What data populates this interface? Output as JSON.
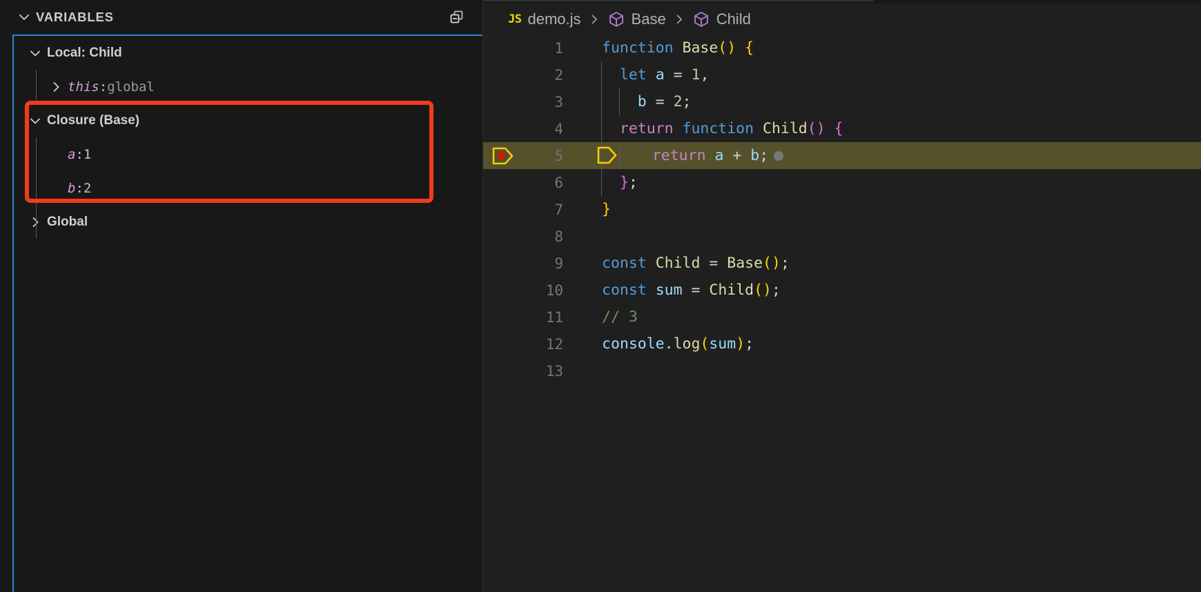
{
  "sidebar": {
    "panel_title": "VARIABLES",
    "twisty_expanded_icon": "chevron-down-icon",
    "collapse_all_icon": "collapse-all-icon",
    "tree": [
      {
        "kind": "scope",
        "label": "Local: Child",
        "expanded": true,
        "icon": "chevron-down-icon",
        "indent": 0
      },
      {
        "kind": "variable",
        "name": "this",
        "separator": ": ",
        "value": "global",
        "value_type": "object",
        "expanded": false,
        "icon": "chevron-right-icon",
        "indent": 1
      },
      {
        "kind": "scope",
        "label": "Closure (Base)",
        "expanded": true,
        "icon": "chevron-down-icon",
        "indent": 0,
        "highlighted": true
      },
      {
        "kind": "variable",
        "name": "a",
        "separator": ": ",
        "value": "1",
        "value_type": "number",
        "indent": 1,
        "highlighted": true
      },
      {
        "kind": "variable",
        "name": "b",
        "separator": ": ",
        "value": "2",
        "value_type": "number",
        "indent": 1,
        "highlighted": true
      },
      {
        "kind": "scope",
        "label": "Global",
        "expanded": false,
        "icon": "chevron-right-icon",
        "indent": 0
      }
    ]
  },
  "annotation": {
    "type": "red-rectangle-highlight",
    "color": "#f03c1e",
    "targets": [
      "Closure (Base)",
      "a: 1",
      "b: 2"
    ]
  },
  "editor": {
    "breadcrumbs": [
      {
        "icon": "js-file-icon",
        "label": "demo.js"
      },
      {
        "icon": "symbol-cube-icon",
        "label": "Base"
      },
      {
        "icon": "symbol-cube-icon",
        "label": "Child"
      }
    ],
    "breadcrumb_separator": "chevron-right-icon",
    "colors": {
      "keyword": "#569cd6",
      "control": "#c586c0",
      "function": "#dcdcaa",
      "variable": "#9cdcfe",
      "number": "#b5cea8",
      "comment": "#6a9955",
      "bracket_level1": "#ffd700",
      "bracket_level2": "#da70d6",
      "current_line_bg": "#55512b",
      "breakpoint": "#e51400",
      "debug_arrow": "#ffcc00"
    },
    "current_line": 5,
    "breakpoint_line": 5,
    "lines": [
      {
        "n": "1",
        "indent_guides": 0,
        "tokens": [
          {
            "t": "function",
            "c": "t-kw"
          },
          {
            "t": " ",
            "c": "t-op"
          },
          {
            "t": "Base",
            "c": "t-fn"
          },
          {
            "t": "()",
            "c": "t-br1"
          },
          {
            "t": " ",
            "c": "t-op"
          },
          {
            "t": "{",
            "c": "t-br1"
          }
        ]
      },
      {
        "n": "2",
        "indent_guides": 1,
        "tokens": [
          {
            "t": "  ",
            "c": "t-op"
          },
          {
            "t": "let",
            "c": "t-kw"
          },
          {
            "t": " ",
            "c": "t-op"
          },
          {
            "t": "a",
            "c": "t-var"
          },
          {
            "t": " = ",
            "c": "t-op"
          },
          {
            "t": "1",
            "c": "t-num"
          },
          {
            "t": ",",
            "c": "t-op"
          }
        ]
      },
      {
        "n": "3",
        "indent_guides": 2,
        "tokens": [
          {
            "t": "    ",
            "c": "t-op"
          },
          {
            "t": "b",
            "c": "t-var"
          },
          {
            "t": " = ",
            "c": "t-op"
          },
          {
            "t": "2",
            "c": "t-num"
          },
          {
            "t": ";",
            "c": "t-op"
          }
        ]
      },
      {
        "n": "4",
        "indent_guides": 1,
        "tokens": [
          {
            "t": "  ",
            "c": "t-op"
          },
          {
            "t": "return",
            "c": "t-ctrl"
          },
          {
            "t": " ",
            "c": "t-op"
          },
          {
            "t": "function",
            "c": "t-kw"
          },
          {
            "t": " ",
            "c": "t-op"
          },
          {
            "t": "Child",
            "c": "t-fn"
          },
          {
            "t": "()",
            "c": "t-br2"
          },
          {
            "t": " ",
            "c": "t-op"
          },
          {
            "t": "{",
            "c": "t-br2"
          }
        ]
      },
      {
        "n": "5",
        "indent_guides": 2,
        "current": true,
        "has_breakpoint": true,
        "has_inline_bp_dot": true,
        "tokens": [
          {
            "t": "   ",
            "c": "t-op"
          },
          {
            "t": "return",
            "c": "t-ctrl"
          },
          {
            "t": " ",
            "c": "t-op"
          },
          {
            "t": "a",
            "c": "t-var"
          },
          {
            "t": " + ",
            "c": "t-op"
          },
          {
            "t": "b",
            "c": "t-var"
          },
          {
            "t": ";",
            "c": "t-op"
          }
        ]
      },
      {
        "n": "6",
        "indent_guides": 1,
        "tokens": [
          {
            "t": "  ",
            "c": "t-op"
          },
          {
            "t": "}",
            "c": "t-br2"
          },
          {
            "t": ";",
            "c": "t-op"
          }
        ]
      },
      {
        "n": "7",
        "indent_guides": 0,
        "tokens": [
          {
            "t": "}",
            "c": "t-br1"
          }
        ]
      },
      {
        "n": "8",
        "indent_guides": 0,
        "tokens": []
      },
      {
        "n": "9",
        "indent_guides": 0,
        "tokens": [
          {
            "t": "const",
            "c": "t-kw"
          },
          {
            "t": " ",
            "c": "t-op"
          },
          {
            "t": "Child",
            "c": "t-fn"
          },
          {
            "t": " = ",
            "c": "t-op"
          },
          {
            "t": "Base",
            "c": "t-fn"
          },
          {
            "t": "()",
            "c": "t-br1"
          },
          {
            "t": ";",
            "c": "t-op"
          }
        ]
      },
      {
        "n": "10",
        "indent_guides": 0,
        "tokens": [
          {
            "t": "const",
            "c": "t-kw"
          },
          {
            "t": " ",
            "c": "t-op"
          },
          {
            "t": "sum",
            "c": "t-var"
          },
          {
            "t": " = ",
            "c": "t-op"
          },
          {
            "t": "Child",
            "c": "t-fn"
          },
          {
            "t": "()",
            "c": "t-br1"
          },
          {
            "t": ";",
            "c": "t-op"
          }
        ]
      },
      {
        "n": "11",
        "indent_guides": 0,
        "tokens": [
          {
            "t": "// 3",
            "c": "t-cmt"
          }
        ]
      },
      {
        "n": "12",
        "indent_guides": 0,
        "tokens": [
          {
            "t": "console",
            "c": "t-var"
          },
          {
            "t": ".",
            "c": "t-op"
          },
          {
            "t": "log",
            "c": "t-fn"
          },
          {
            "t": "(",
            "c": "t-br1"
          },
          {
            "t": "sum",
            "c": "t-var"
          },
          {
            "t": ")",
            "c": "t-br1"
          },
          {
            "t": ";",
            "c": "t-op"
          }
        ]
      },
      {
        "n": "13",
        "indent_guides": 0,
        "tokens": []
      }
    ]
  }
}
